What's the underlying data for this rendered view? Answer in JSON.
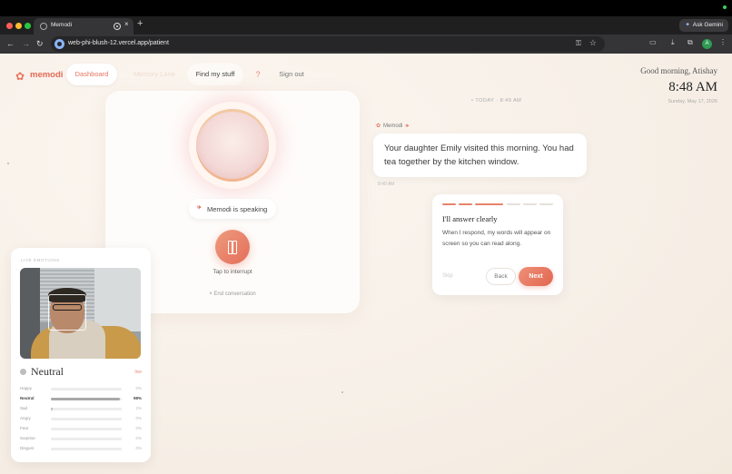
{
  "browser": {
    "tab_title": "Memodi",
    "new_tab": "+",
    "tab_close": "×",
    "url": "web-phi-blush-12.vercel.app/patient",
    "gemini_label": "Ask Gemini",
    "profile_initial": "A"
  },
  "header": {
    "logo": "memodi",
    "nav": {
      "dashboard": "Dashboard",
      "memory_lane": "Memory Lane",
      "find_my_stuff": "Find my stuff",
      "help": "?",
      "sign_out": "Sign out"
    },
    "greeting": "Good morning, Atishay",
    "time": "8:48 AM",
    "date": "Sunday, May 17, 2026"
  },
  "speaking": {
    "status": "Memodi is speaking",
    "tap_label": "Tap to interrupt",
    "end_conversation": "End conversation"
  },
  "chat": {
    "divider": "• TODAY · 8:49 AM",
    "sender": "Memodi",
    "message": "Your daughter Emily visited this morning. You had tea together by the kitchen window.",
    "time": "8:49 AM"
  },
  "onboarding": {
    "title": "I'll answer clearly",
    "body": "When I respond, my words will appear on screen so you can read along.",
    "skip": "Skip",
    "back": "Back",
    "next": "Next"
  },
  "emotions": {
    "header": "LIVE EMOTIONS",
    "current": "Neutral",
    "live": "live",
    "items": [
      {
        "name": "Happy",
        "pct": "0%",
        "value": 0
      },
      {
        "name": "Neutral",
        "pct": "98%",
        "value": 98
      },
      {
        "name": "Sad",
        "pct": "2%",
        "value": 2
      },
      {
        "name": "Angry",
        "pct": "0%",
        "value": 0
      },
      {
        "name": "Fear",
        "pct": "0%",
        "value": 0
      },
      {
        "name": "Surprise",
        "pct": "0%",
        "value": 0
      },
      {
        "name": "Disgust",
        "pct": "0%",
        "value": 0
      }
    ]
  },
  "colors": {
    "accent": "#e5755f",
    "background": "#f7f1ea"
  }
}
